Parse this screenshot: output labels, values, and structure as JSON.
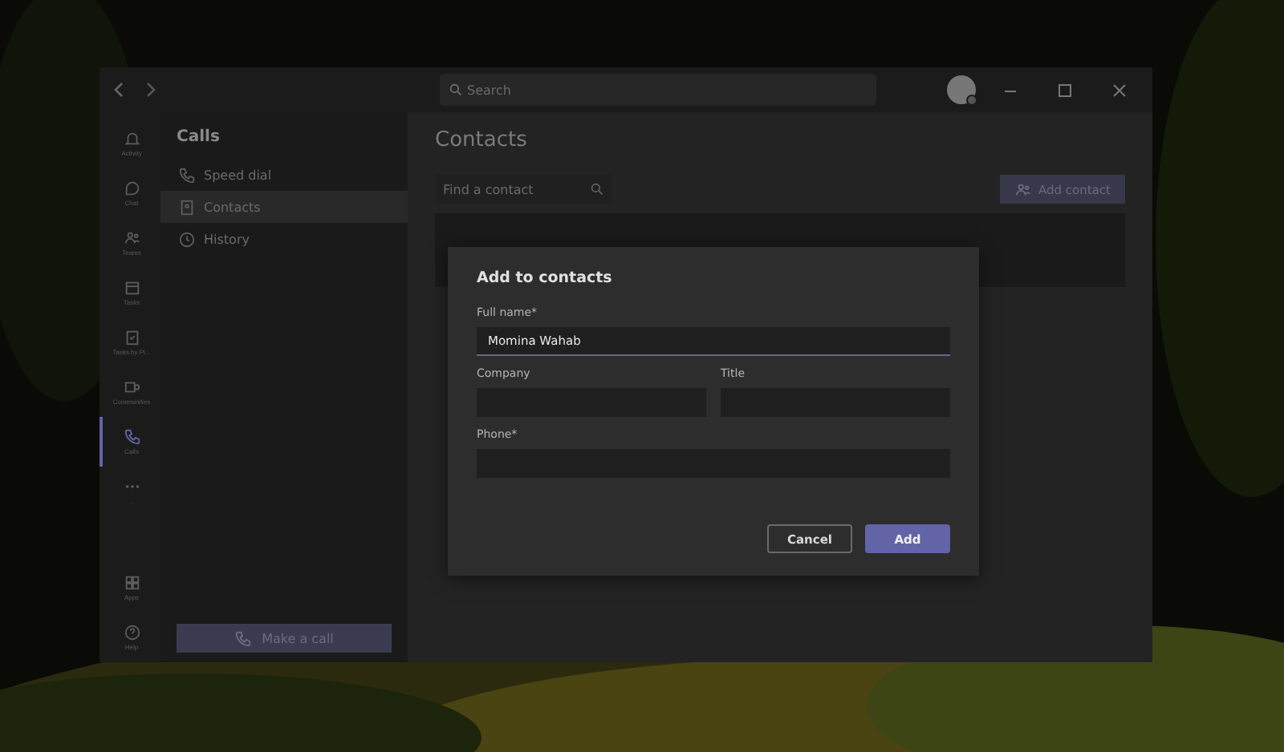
{
  "titlebar": {
    "search": {
      "placeholder": "Search"
    }
  },
  "rail": [
    {
      "label": "Activity",
      "selected": false
    },
    {
      "label": "Chat",
      "selected": false
    },
    {
      "label": "Teams",
      "selected": false
    },
    {
      "label": "Tasks",
      "selected": false
    },
    {
      "label": "Tasks by Pl...",
      "selected": false
    },
    {
      "label": "Communities",
      "selected": false
    },
    {
      "label": "Calls",
      "selected": true
    },
    {
      "label": "...",
      "selected": false
    }
  ],
  "rail_bottom": [
    {
      "label": "Apps"
    },
    {
      "label": "Help"
    }
  ],
  "sidebar": {
    "title": "Calls",
    "items": [
      {
        "label": "Speed dial",
        "selected": false
      },
      {
        "label": "Contacts",
        "selected": true
      },
      {
        "label": "History",
        "selected": false
      }
    ],
    "button": "Make a call"
  },
  "main": {
    "title": "Contacts",
    "search": {
      "placeholder": "Find a contact"
    },
    "add_button": "Add contact"
  },
  "dialog": {
    "title": "Add to contacts",
    "fields": [
      {
        "label": "Full name*",
        "value": "Momina Wahab",
        "focused": true
      },
      {
        "label": "Company",
        "focused": false
      },
      {
        "label": "Title",
        "focused": false
      },
      {
        "label": "Phone*",
        "focused": false
      }
    ],
    "buttons": [
      {
        "label": "Cancel",
        "kind": "secondary"
      },
      {
        "label": "Add",
        "kind": "primary"
      }
    ]
  }
}
